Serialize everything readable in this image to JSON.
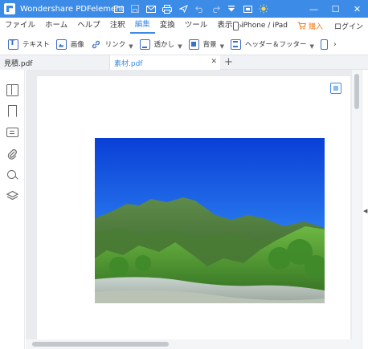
{
  "titlebar": {
    "app_title": "Wondershare PDFelement",
    "icons": [
      "folder-icon",
      "save-icon",
      "mail-icon",
      "print-icon",
      "share-icon",
      "undo-icon",
      "redo-icon",
      "dropdown-icon",
      "bell-icon",
      "theme-icon"
    ],
    "window_buttons": {
      "minimize": "—",
      "maximize": "☐",
      "close": "✕"
    }
  },
  "menu": {
    "items": [
      "ファイル",
      "ホーム",
      "ヘルプ",
      "注釈",
      "編集",
      "変換",
      "ツール",
      "表示"
    ],
    "active": "編集",
    "device_label": "iPhone / iPad",
    "buy_label": "購入",
    "login_label": "ログイン"
  },
  "ribbon": {
    "text_label": "テキスト",
    "image_label": "画像",
    "link_label": "リンク",
    "watermark_label": "透かし",
    "background_label": "背景",
    "header_footer_label": "ヘッダー＆フッター"
  },
  "tabs": {
    "items": [
      "見積.pdf",
      "素材.pdf"
    ],
    "active": "素材.pdf"
  },
  "sidebar": {
    "icons": [
      "pages-icon",
      "bookmark-icon",
      "comment-icon",
      "attachment-icon",
      "search-icon",
      "layers-icon"
    ]
  },
  "colors": {
    "accent": "#3c8ce7",
    "buy": "#f07a1e",
    "canvas_bg": "#e9ebef"
  }
}
